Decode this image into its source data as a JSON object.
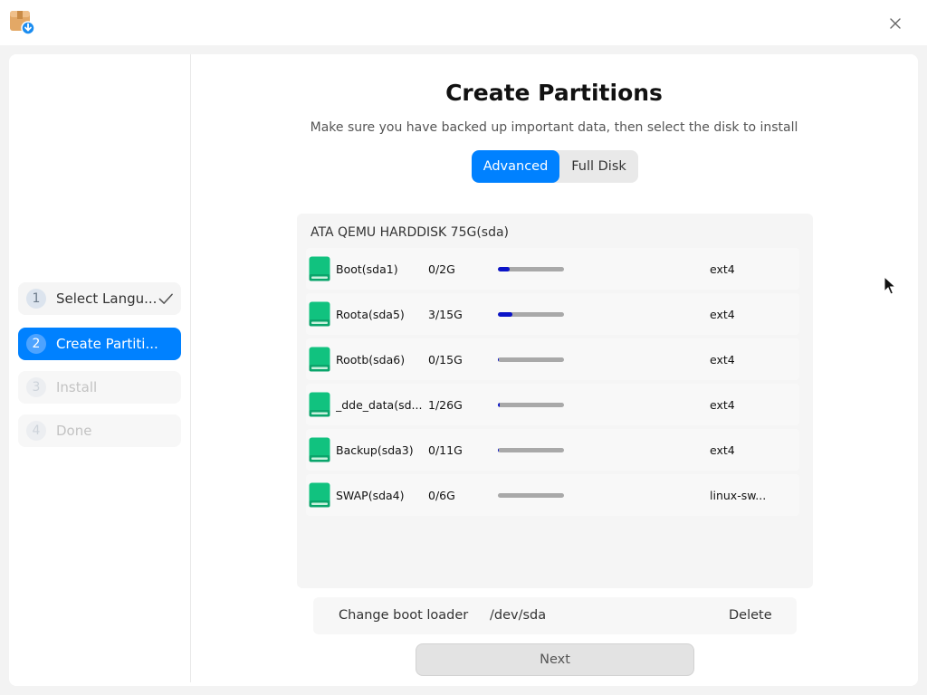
{
  "window": {
    "icons": {
      "app": "installer-package-icon",
      "close": "close-icon"
    }
  },
  "sidebar": {
    "steps": [
      {
        "number": "1",
        "label": "Select Langu...",
        "state": "completed"
      },
      {
        "number": "2",
        "label": "Create Partiti...",
        "state": "active"
      },
      {
        "number": "3",
        "label": "Install",
        "state": "disabled"
      },
      {
        "number": "4",
        "label": "Done",
        "state": "disabled"
      }
    ]
  },
  "main": {
    "title": "Create Partitions",
    "subtitle": "Make sure you have backed up important data, then select the disk to install",
    "mode_tabs": [
      {
        "label": "Advanced",
        "selected": true
      },
      {
        "label": "Full Disk",
        "selected": false
      }
    ],
    "disk": {
      "name": "ATA QEMU HARDDISK 75G(sda)",
      "partitions": [
        {
          "name": "Boot(sda1)",
          "usage": "0/2G",
          "usage_fraction": 0.18,
          "fs": "ext4"
        },
        {
          "name": "Roota(sda5)",
          "usage": "3/15G",
          "usage_fraction": 0.22,
          "fs": "ext4"
        },
        {
          "name": "Rootb(sda6)",
          "usage": "0/15G",
          "usage_fraction": 0.02,
          "fs": "ext4"
        },
        {
          "name": "_dde_data(sd...",
          "usage": "1/26G",
          "usage_fraction": 0.03,
          "fs": "ext4"
        },
        {
          "name": "Backup(sda3)",
          "usage": "0/11G",
          "usage_fraction": 0.02,
          "fs": "ext4"
        },
        {
          "name": "SWAP(sda4)",
          "usage": "0/6G",
          "usage_fraction": 0.0,
          "fs": "linux-sw..."
        }
      ]
    },
    "bottom_bar": {
      "change_boot_loader": "Change boot loader",
      "boot_device": "/dev/sda",
      "delete": "Delete"
    },
    "next_label": "Next"
  },
  "colors": {
    "accent": "#0081ff",
    "usage_fill": "#0b14c8",
    "disk_icon": "#11c27f"
  }
}
